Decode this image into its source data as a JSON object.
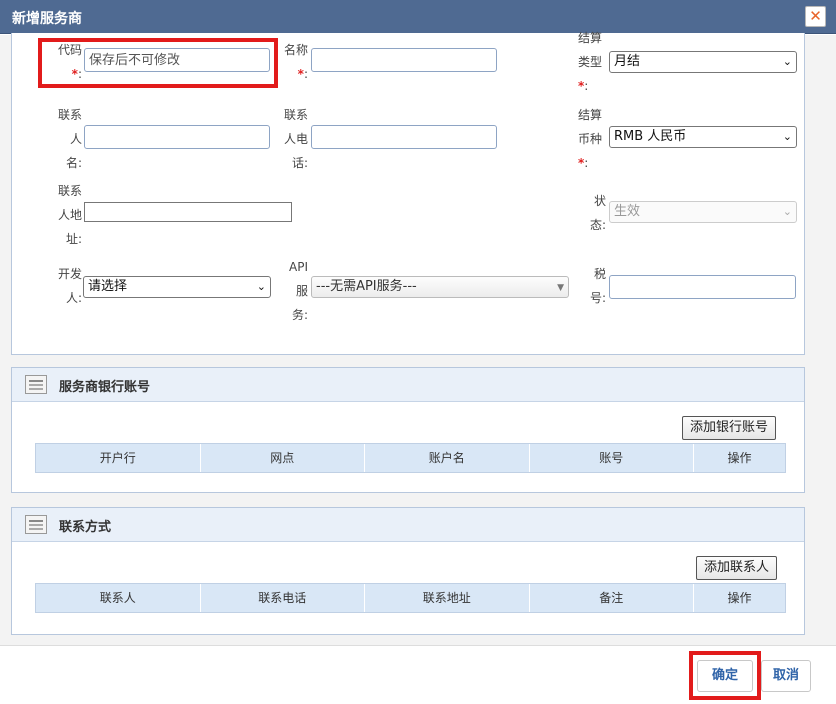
{
  "dialog": {
    "title": "新增服务商",
    "close_symbol": "✕"
  },
  "form": {
    "code": {
      "label": "代码",
      "colon": ":",
      "required": "*",
      "placeholder": "保存后不可修改"
    },
    "name": {
      "label": "名称",
      "colon": ":",
      "required": "*",
      "value": ""
    },
    "settle_type": {
      "label_line1": "结算",
      "label_line2": "类型",
      "colon": ":",
      "required": "*",
      "value": "月结"
    },
    "contact_person": {
      "label_line1": "联系",
      "label_line2": "人",
      "label_line3": "名:",
      "value": ""
    },
    "contact_phone": {
      "label_line1": "联系",
      "label_line2": "人电",
      "label_line3": "话:",
      "value": ""
    },
    "settle_currency": {
      "label_line1": "结算",
      "label_line2": "币种",
      "colon": ":",
      "required": "*",
      "value": "RMB 人民币"
    },
    "contact_address": {
      "label_line1": "联系",
      "label_line2": "人地",
      "label_line3": "址:",
      "value": ""
    },
    "status": {
      "label_line1": "状",
      "label_line2": "态:",
      "value": "生效"
    },
    "developer": {
      "label_line1": "开发",
      "label_line2": "人:",
      "value": "请选择"
    },
    "api_service": {
      "label_line1": "API",
      "label_line2": "服",
      "label_line3": "务:",
      "value": "---无需API服务---"
    },
    "tax_no": {
      "label_line1": "税",
      "label_line2": "号:",
      "value": ""
    }
  },
  "bank_section": {
    "title": "服务商银行账号",
    "add_button": "添加银行账号",
    "columns": [
      "开户行",
      "网点",
      "账户名",
      "账号",
      "操作"
    ]
  },
  "contact_section": {
    "title": "联系方式",
    "add_button": "添加联系人",
    "columns": [
      "联系人",
      "联系电话",
      "联系地址",
      "备注",
      "操作"
    ]
  },
  "footer": {
    "confirm": "确定",
    "cancel": "取消"
  },
  "colors": {
    "titlebar": "#4f6a92",
    "highlight": "#e21b1b",
    "table_header": "#d9e7f6",
    "button_text": "#2f63a8"
  },
  "icons": {
    "close": "close-icon",
    "section": "document-icon",
    "dropdown": "chevron-down-icon"
  }
}
